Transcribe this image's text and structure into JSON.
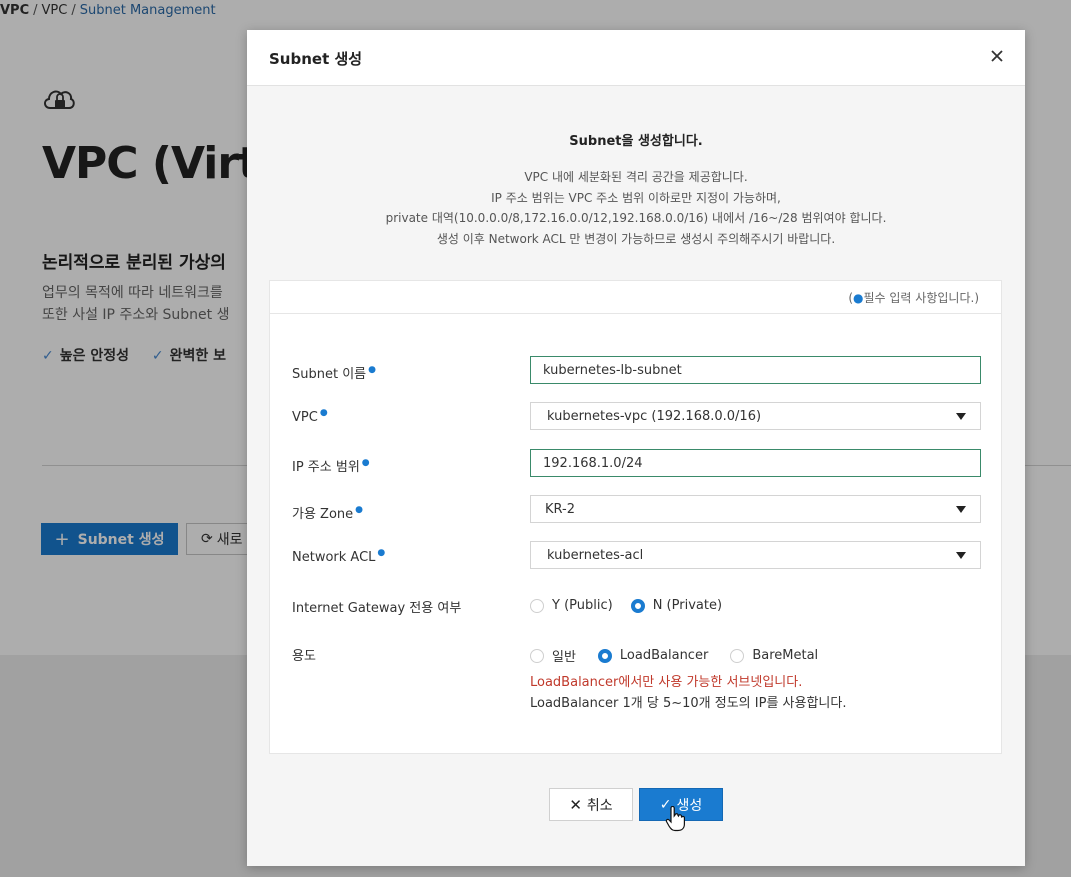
{
  "background": {
    "breadcrumb": [
      "VPC",
      "VPC",
      "Subnet Management"
    ],
    "title": "VPC (Virt",
    "subtitle": "논리적으로 분리된 가상의",
    "desc_lines": [
      "업무의 목적에 따라 네트워크를",
      "또한 사설 IP 주소와 Subnet 생"
    ],
    "features": [
      "높은 안정성",
      "완벽한 보"
    ],
    "create_button": "Subnet 생성",
    "refresh_button": "새로"
  },
  "modal": {
    "title": "Subnet 생성",
    "intro_heading": "Subnet을 생성합니다.",
    "intro_lines": [
      "VPC 내에 세분화된 격리 공간을 제공합니다.",
      "IP 주소 범위는 VPC 주소 범위 이하로만 지정이 가능하며,",
      "private 대역(10.0.0.0/8,172.16.0.0/12,192.168.0.0/16) 내에서 /16~/28 범위여야 합니다.",
      "생성 이후 Network ACL 만 변경이 가능하므로 생성시 주의해주시기 바랍니다."
    ],
    "required_note": "필수 입력 사항입니다.",
    "fields": {
      "subnet_name": {
        "label": "Subnet 이름",
        "value": "kubernetes-lb-subnet"
      },
      "vpc": {
        "label": "VPC",
        "value": "kubernetes-vpc (192.168.0.0/16)"
      },
      "ip_range": {
        "label": "IP 주소 범위",
        "value": "192.168.1.0/24"
      },
      "zone": {
        "label": "가용 Zone",
        "value": "KR-2"
      },
      "network_acl": {
        "label": "Network ACL",
        "value": "kubernetes-acl"
      },
      "igw": {
        "label": "Internet Gateway 전용 여부",
        "options": [
          "Y (Public)",
          "N (Private)"
        ],
        "selected": "N (Private)"
      },
      "usage": {
        "label": "용도",
        "options": [
          "일반",
          "LoadBalancer",
          "BareMetal"
        ],
        "selected": "LoadBalancer"
      }
    },
    "usage_warning": "LoadBalancer에서만 사용 가능한 서브넷입니다.",
    "usage_info": "LoadBalancer 1개 당 5~10개 정도의 IP를 사용합니다.",
    "cancel_label": "취소",
    "create_label": "생성"
  },
  "colors": {
    "accent": "#1a7bd0",
    "warning": "#c0392b"
  }
}
